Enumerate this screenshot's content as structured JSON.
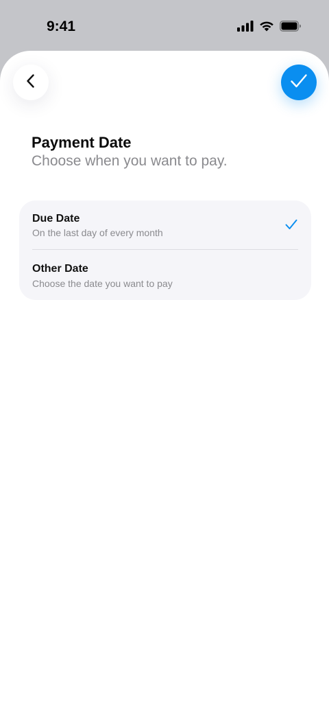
{
  "status_bar": {
    "time": "9:41",
    "icons": [
      "signal-icon",
      "wifi-icon",
      "battery-icon"
    ]
  },
  "header": {
    "back_icon": "chevron-left-icon",
    "confirm_icon": "checkmark-icon",
    "confirm_color": "#0a8ef0"
  },
  "page": {
    "title": "Payment Date",
    "subtitle": "Choose when you want to pay."
  },
  "options": [
    {
      "title": "Due Date",
      "description": "On the last day of every month",
      "selected": true
    },
    {
      "title": "Other Date",
      "description": "Choose the date you want to pay",
      "selected": false
    }
  ],
  "colors": {
    "accent": "#0a8ef0",
    "card_background": "#f5f5f9",
    "muted_text": "#8a8a8e"
  }
}
